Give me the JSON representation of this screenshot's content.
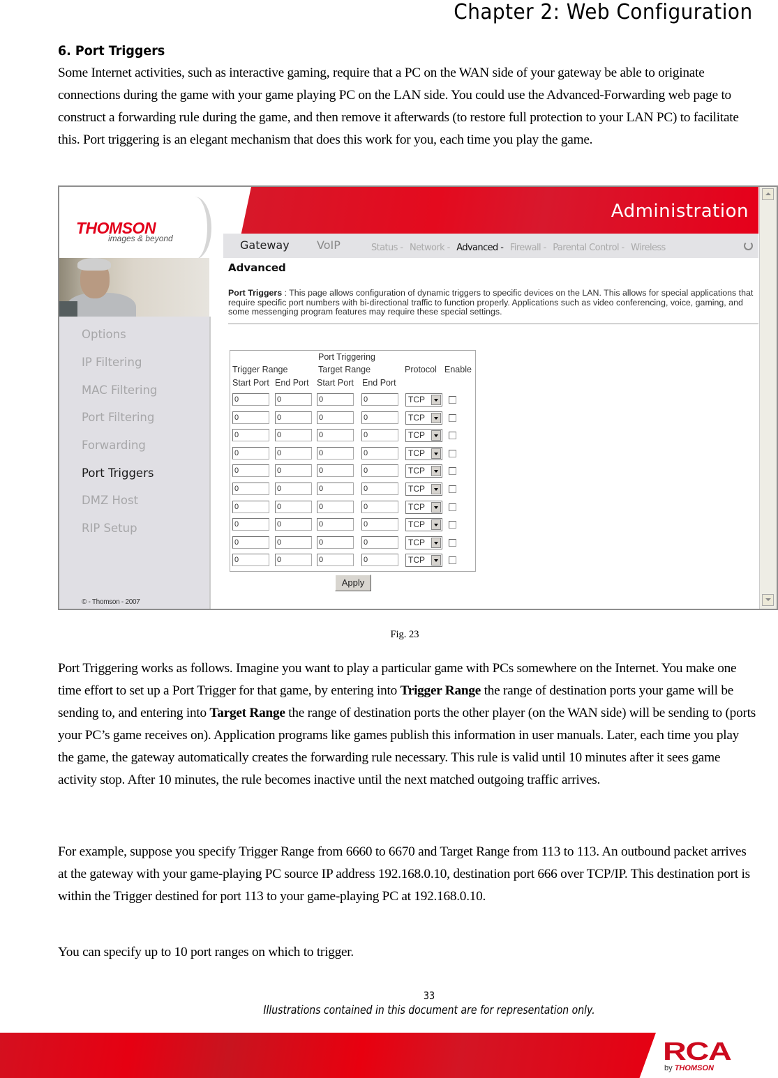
{
  "document": {
    "chapter_title": "Chapter 2: Web Configuration",
    "section_heading": "6. Port Triggers",
    "intro_paragraph": "Some Internet activities, such as interactive gaming, require that a PC on the WAN side of your gateway be able to originate connections during the game with your game playing PC on the LAN side. You could use the Advanced-Forwarding web page to construct a forwarding rule during the game, and then remove it afterwards (to restore full protection to your LAN PC) to facilitate this. Port triggering is an elegant mechanism that does this work for you, each time you play the game.",
    "figure_caption": "Fig. 23",
    "para2": {
      "part1": "Port Triggering works as follows. Imagine you want to play a particular game with PCs somewhere on the Internet. You make one time effort to set up a Port Trigger for that game, by entering into ",
      "bold1": "Trigger Range",
      "part2": " the range of destination ports your game will be sending to, and entering into ",
      "bold2": "Target Range",
      "part3": " the range of destination ports the other player (on the WAN side) will be sending to (ports your PC’s game receives on). Application programs like games publish this information in user manuals. Later, each time you play the game, the gateway automatically creates the forwarding rule necessary. This rule is valid until 10 minutes after it sees game activity stop. After 10 minutes, the rule becomes inactive until the next matched outgoing traffic arrives."
    },
    "para3": "For example, suppose you specify Trigger Range from 6660 to 6670 and Target Range from 113 to 113. An outbound packet arrives at the gateway with your game-playing PC source IP address 192.168.0.10, destination port 666 over TCP/IP. This destination port is within the Trigger destined for port 113 to your game-playing PC at 192.168.0.10.",
    "para4": "You can specify up to 10 port ranges on which to trigger.",
    "page_number": "33",
    "disclaimer": "Illustrations contained in this document are for representation only.",
    "footer_logo": {
      "brand": "RCA",
      "by": "by",
      "company": "THOMSON"
    }
  },
  "screenshot": {
    "logo": {
      "brand": "THOMSON",
      "tagline": "images & beyond"
    },
    "banner_title": "Administration",
    "main_nav": [
      {
        "label": "Gateway",
        "active": true
      },
      {
        "label": "VoIP",
        "active": false
      }
    ],
    "sub_nav": [
      {
        "label": "Status -",
        "active": false
      },
      {
        "label": "Network -",
        "active": false
      },
      {
        "label": "Advanced -",
        "active": true
      },
      {
        "label": "Firewall -",
        "active": false
      },
      {
        "label": "Parental Control -",
        "active": false
      },
      {
        "label": "Wireless",
        "active": false
      }
    ],
    "sidebar": {
      "items": [
        {
          "label": "Options",
          "active": false
        },
        {
          "label": "IP Filtering",
          "active": false
        },
        {
          "label": "MAC Filtering",
          "active": false
        },
        {
          "label": "Port Filtering",
          "active": false
        },
        {
          "label": "Forwarding",
          "active": false
        },
        {
          "label": "Port Triggers",
          "active": true
        },
        {
          "label": "DMZ Host",
          "active": false
        },
        {
          "label": "RIP Setup",
          "active": false
        }
      ],
      "copyright": "© - Thomson - 2007"
    },
    "page_heading": "Advanced",
    "description": {
      "label": "Port Triggers",
      "separator": " : ",
      "text": "This page allows configuration of dynamic triggers to specific devices on the LAN. This allows for special applications that require specific port numbers with bi-directional traffic to function properly. Applications such as video conferencing, voice, gaming, and some messenging program features may require these special settings."
    },
    "table": {
      "caption": "Port Triggering",
      "group_headers": {
        "trigger": "Trigger Range",
        "target": "Target Range",
        "protocol": "Protocol",
        "enable": "Enable"
      },
      "sub_headers": [
        "Start Port",
        "End Port",
        "Start Port",
        "End Port"
      ],
      "rows": [
        {
          "trigger_start": "0",
          "trigger_end": "0",
          "target_start": "0",
          "target_end": "0",
          "protocol": "TCP",
          "enabled": false
        },
        {
          "trigger_start": "0",
          "trigger_end": "0",
          "target_start": "0",
          "target_end": "0",
          "protocol": "TCP",
          "enabled": false
        },
        {
          "trigger_start": "0",
          "trigger_end": "0",
          "target_start": "0",
          "target_end": "0",
          "protocol": "TCP",
          "enabled": false
        },
        {
          "trigger_start": "0",
          "trigger_end": "0",
          "target_start": "0",
          "target_end": "0",
          "protocol": "TCP",
          "enabled": false
        },
        {
          "trigger_start": "0",
          "trigger_end": "0",
          "target_start": "0",
          "target_end": "0",
          "protocol": "TCP",
          "enabled": false
        },
        {
          "trigger_start": "0",
          "trigger_end": "0",
          "target_start": "0",
          "target_end": "0",
          "protocol": "TCP",
          "enabled": false
        },
        {
          "trigger_start": "0",
          "trigger_end": "0",
          "target_start": "0",
          "target_end": "0",
          "protocol": "TCP",
          "enabled": false
        },
        {
          "trigger_start": "0",
          "trigger_end": "0",
          "target_start": "0",
          "target_end": "0",
          "protocol": "TCP",
          "enabled": false
        },
        {
          "trigger_start": "0",
          "trigger_end": "0",
          "target_start": "0",
          "target_end": "0",
          "protocol": "TCP",
          "enabled": false
        },
        {
          "trigger_start": "0",
          "trigger_end": "0",
          "target_start": "0",
          "target_end": "0",
          "protocol": "TCP",
          "enabled": false
        }
      ],
      "apply_label": "Apply"
    },
    "colors": {
      "brand_red": "#e2001a",
      "sidebar_bg": "#e0dfe4",
      "nav_bg": "#e3e3e6"
    }
  }
}
